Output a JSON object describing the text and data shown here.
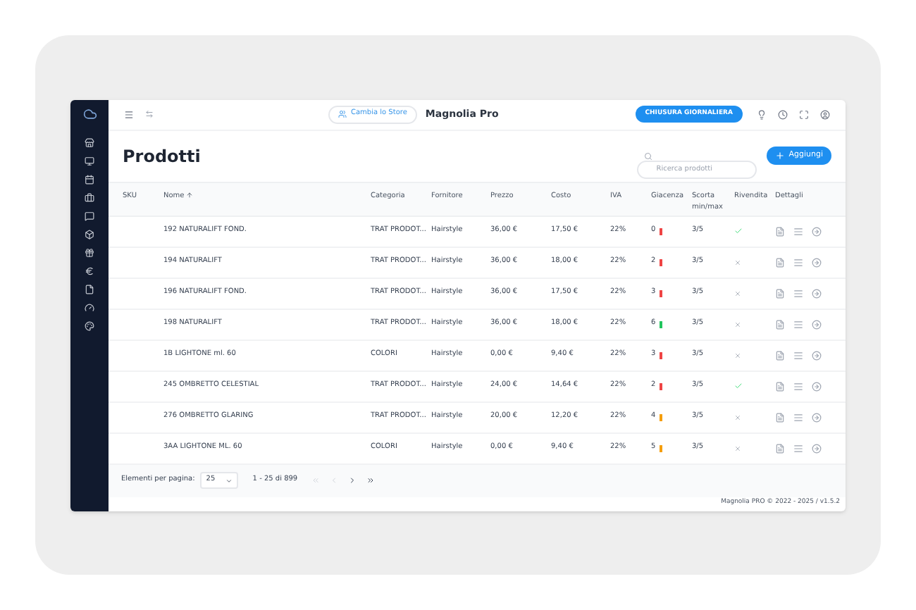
{
  "topbar": {
    "store_button": "Cambia lo Store",
    "store_name": "Magnolia Pro",
    "close_button": "CHIUSURA GIORNALIERA"
  },
  "page_title": "Prodotti",
  "search": {
    "placeholder": "Ricerca prodotti"
  },
  "add_button": "Aggiungi",
  "table": {
    "columns": [
      {
        "label": "SKU"
      },
      {
        "label": "Nome",
        "sorted": true
      },
      {
        "label": "Categoria"
      },
      {
        "label": "Fornitore"
      },
      {
        "label": "Prezzo"
      },
      {
        "label": "Costo"
      },
      {
        "label": "IVA"
      },
      {
        "label": "Giacenza"
      },
      {
        "label": "Scorta min/max"
      },
      {
        "label": "Rivendita"
      },
      {
        "label": "Dettagli"
      }
    ],
    "rows": [
      {
        "nome": "192 NATURALIFT FOND.",
        "categoria": "TRAT PRODOT...",
        "fornitore": "Hairstyle",
        "prezzo": "36,00 €",
        "costo": "17,50 €",
        "iva": "22%",
        "giacenza": "0",
        "color": "#ef4444",
        "scorta": "3/5",
        "rivendita": true
      },
      {
        "nome": "194 NATURALIFT",
        "categoria": "TRAT PRODOT...",
        "fornitore": "Hairstyle",
        "prezzo": "36,00 €",
        "costo": "18,00 €",
        "iva": "22%",
        "giacenza": "2",
        "color": "#ef4444",
        "scorta": "3/5",
        "rivendita": false
      },
      {
        "nome": "196 NATURALIFT FOND.",
        "categoria": "TRAT PRODOT...",
        "fornitore": "Hairstyle",
        "prezzo": "36,00 €",
        "costo": "17,50 €",
        "iva": "22%",
        "giacenza": "3",
        "color": "#ef4444",
        "scorta": "3/5",
        "rivendita": false
      },
      {
        "nome": "198 NATURALIFT",
        "categoria": "TRAT PRODOT...",
        "fornitore": "Hairstyle",
        "prezzo": "36,00 €",
        "costo": "18,00 €",
        "iva": "22%",
        "giacenza": "6",
        "color": "#22c55e",
        "scorta": "3/5",
        "rivendita": false
      },
      {
        "nome": "1B LIGHTONE ml. 60",
        "categoria": "COLORI",
        "fornitore": "Hairstyle",
        "prezzo": "0,00 €",
        "costo": "9,40 €",
        "iva": "22%",
        "giacenza": "3",
        "color": "#ef4444",
        "scorta": "3/5",
        "rivendita": false
      },
      {
        "nome": "245 OMBRETTO CELESTIAL",
        "categoria": "TRAT PRODOT...",
        "fornitore": "Hairstyle",
        "prezzo": "24,00 €",
        "costo": "14,64 €",
        "iva": "22%",
        "giacenza": "2",
        "color": "#ef4444",
        "scorta": "3/5",
        "rivendita": true
      },
      {
        "nome": "276 OMBRETTO GLARING",
        "categoria": "TRAT PRODOT...",
        "fornitore": "Hairstyle",
        "prezzo": "20,00 €",
        "costo": "12,20 €",
        "iva": "22%",
        "giacenza": "4",
        "color": "#f59e0b",
        "scorta": "3/5",
        "rivendita": false
      },
      {
        "nome": "3AA LIGHTONE ML. 60",
        "categoria": "COLORI",
        "fornitore": "Hairstyle",
        "prezzo": "0,00 €",
        "costo": "9,40 €",
        "iva": "22%",
        "giacenza": "5",
        "color": "#f59e0b",
        "scorta": "3/5",
        "rivendita": false
      }
    ]
  },
  "pagination": {
    "label": "Elementi per pagina:",
    "page_size": "25",
    "range": "1 - 25 di 899"
  },
  "footer": "Magnolia PRO © 2022 - 2025 / v1.5.2"
}
